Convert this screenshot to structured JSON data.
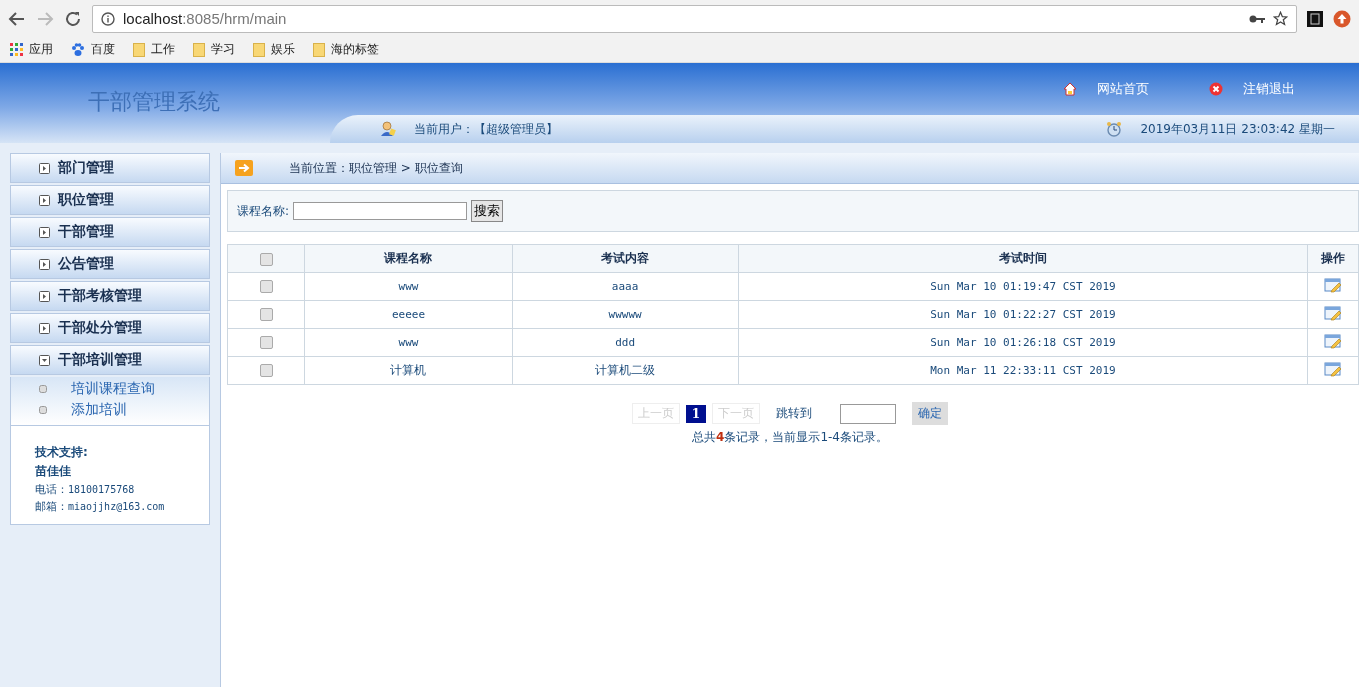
{
  "browser": {
    "url_host": "localhost",
    "url_path": ":8085/hrm/main",
    "bookmarks": [
      {
        "kind": "apps",
        "label": "应用"
      },
      {
        "kind": "paw",
        "label": "百度"
      },
      {
        "kind": "folder",
        "label": "工作"
      },
      {
        "kind": "folder",
        "label": "学习"
      },
      {
        "kind": "folder",
        "label": "娱乐"
      },
      {
        "kind": "folder",
        "label": "海的标签"
      }
    ]
  },
  "header": {
    "title": "干部管理系统",
    "links": [
      {
        "kind": "home",
        "label": "网站首页"
      },
      {
        "kind": "logout",
        "label": "注销退出"
      }
    ],
    "user_label": "当前用户：【超级管理员】",
    "datetime": "2019年03月11日 23:03:42 星期一"
  },
  "sidebar": {
    "items": [
      {
        "label": "部门管理",
        "expanded": false
      },
      {
        "label": "职位管理",
        "expanded": false
      },
      {
        "label": "干部管理",
        "expanded": false
      },
      {
        "label": "公告管理",
        "expanded": false
      },
      {
        "label": "干部考核管理",
        "expanded": false
      },
      {
        "label": "干部处分管理",
        "expanded": false
      },
      {
        "label": "干部培训管理",
        "expanded": true,
        "children": [
          {
            "label": "培训课程查询"
          },
          {
            "label": "添加培训"
          }
        ]
      }
    ],
    "support": {
      "heading": "技术支持:",
      "name": "苗佳佳",
      "phone_label": "电话：",
      "phone": "18100175768",
      "email_label": "邮箱：",
      "email": "miaojjhz@163.com"
    }
  },
  "breadcrumb": "当前位置：职位管理 > 职位查询",
  "search": {
    "label": "课程名称:",
    "button": "搜索"
  },
  "table": {
    "select_all_checked": false,
    "columns": [
      "课程名称",
      "考试内容",
      "考试时间",
      "操作"
    ],
    "rows": [
      {
        "checked": false,
        "cells": [
          "www",
          "aaaa",
          "Sun Mar 10 01:19:47 CST 2019"
        ]
      },
      {
        "checked": false,
        "cells": [
          "eeeee",
          "wwwww",
          "Sun Mar 10 01:22:27 CST 2019"
        ]
      },
      {
        "checked": false,
        "cells": [
          "www",
          "ddd",
          "Sun Mar 10 01:26:18 CST 2019"
        ]
      },
      {
        "checked": false,
        "cells": [
          "计算机",
          "计算机二级",
          "Mon Mar 11 22:33:11 CST 2019"
        ]
      }
    ]
  },
  "pagination": {
    "prev": "上一页",
    "pages": [
      {
        "label": "1",
        "selected": true
      }
    ],
    "next": "下一页",
    "jump_label": "跳转到",
    "confirm": "确定",
    "summary_prefix": "总共",
    "summary_count": "4",
    "summary_suffix": "条记录，当前显示1-4条记录。"
  }
}
